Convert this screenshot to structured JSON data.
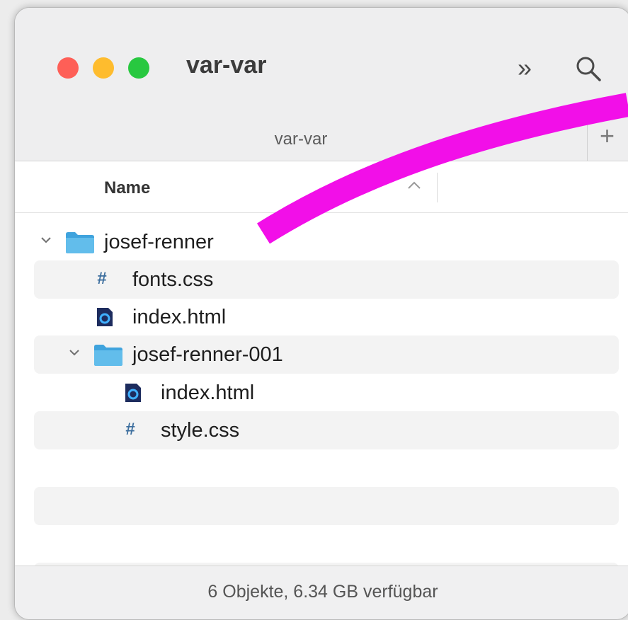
{
  "window": {
    "title": "var-var"
  },
  "toolbar": {
    "more_icon": "chevron-double-right-icon",
    "search_icon": "search-icon"
  },
  "tabs": {
    "items": [
      {
        "label": "var-var"
      }
    ],
    "add_icon": "plus-icon"
  },
  "columns": {
    "name_label": "Name",
    "sort_direction": "ascending"
  },
  "files": [
    {
      "name": "josef-renner",
      "kind": "folder",
      "expanded": true
    },
    {
      "name": "fonts.css",
      "kind": "css"
    },
    {
      "name": "index.html",
      "kind": "html"
    },
    {
      "name": "josef-renner-001",
      "kind": "folder",
      "expanded": true
    },
    {
      "name": "index.html",
      "kind": "html"
    },
    {
      "name": "style.css",
      "kind": "css"
    }
  ],
  "status": {
    "text": "6 Objekte, 6.34 GB verfügbar"
  },
  "colors": {
    "close": "#fe5f57",
    "minimize": "#febc2e",
    "zoom": "#28c840",
    "folder": "#4bb0e6",
    "annotation": "#f20fe8"
  }
}
